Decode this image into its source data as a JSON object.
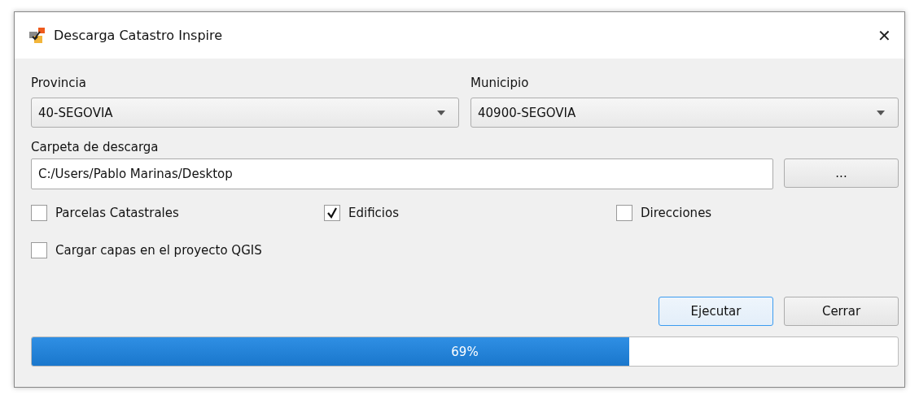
{
  "window": {
    "title": "Descarga Catastro Inspire",
    "close": "✕"
  },
  "provincia": {
    "label": "Provincia",
    "value": "40-SEGOVIA"
  },
  "municipio": {
    "label": "Municipio",
    "value": "40900-SEGOVIA"
  },
  "carpeta": {
    "label": "Carpeta de descarga",
    "value": "C:/Users/Pablo Marinas/Desktop",
    "browse": "..."
  },
  "layers": [
    {
      "label": "Parcelas Catastrales",
      "checked": false
    },
    {
      "label": "Edificios",
      "checked": true
    },
    {
      "label": "Direcciones",
      "checked": false
    }
  ],
  "load_project": {
    "label": "Cargar capas en el proyecto QGIS",
    "checked": false
  },
  "buttons": [
    {
      "label": "Ejecutar",
      "focused": true
    },
    {
      "label": "Cerrar",
      "focused": false
    }
  ],
  "progress": {
    "level": 0.69,
    "text": "69%"
  }
}
